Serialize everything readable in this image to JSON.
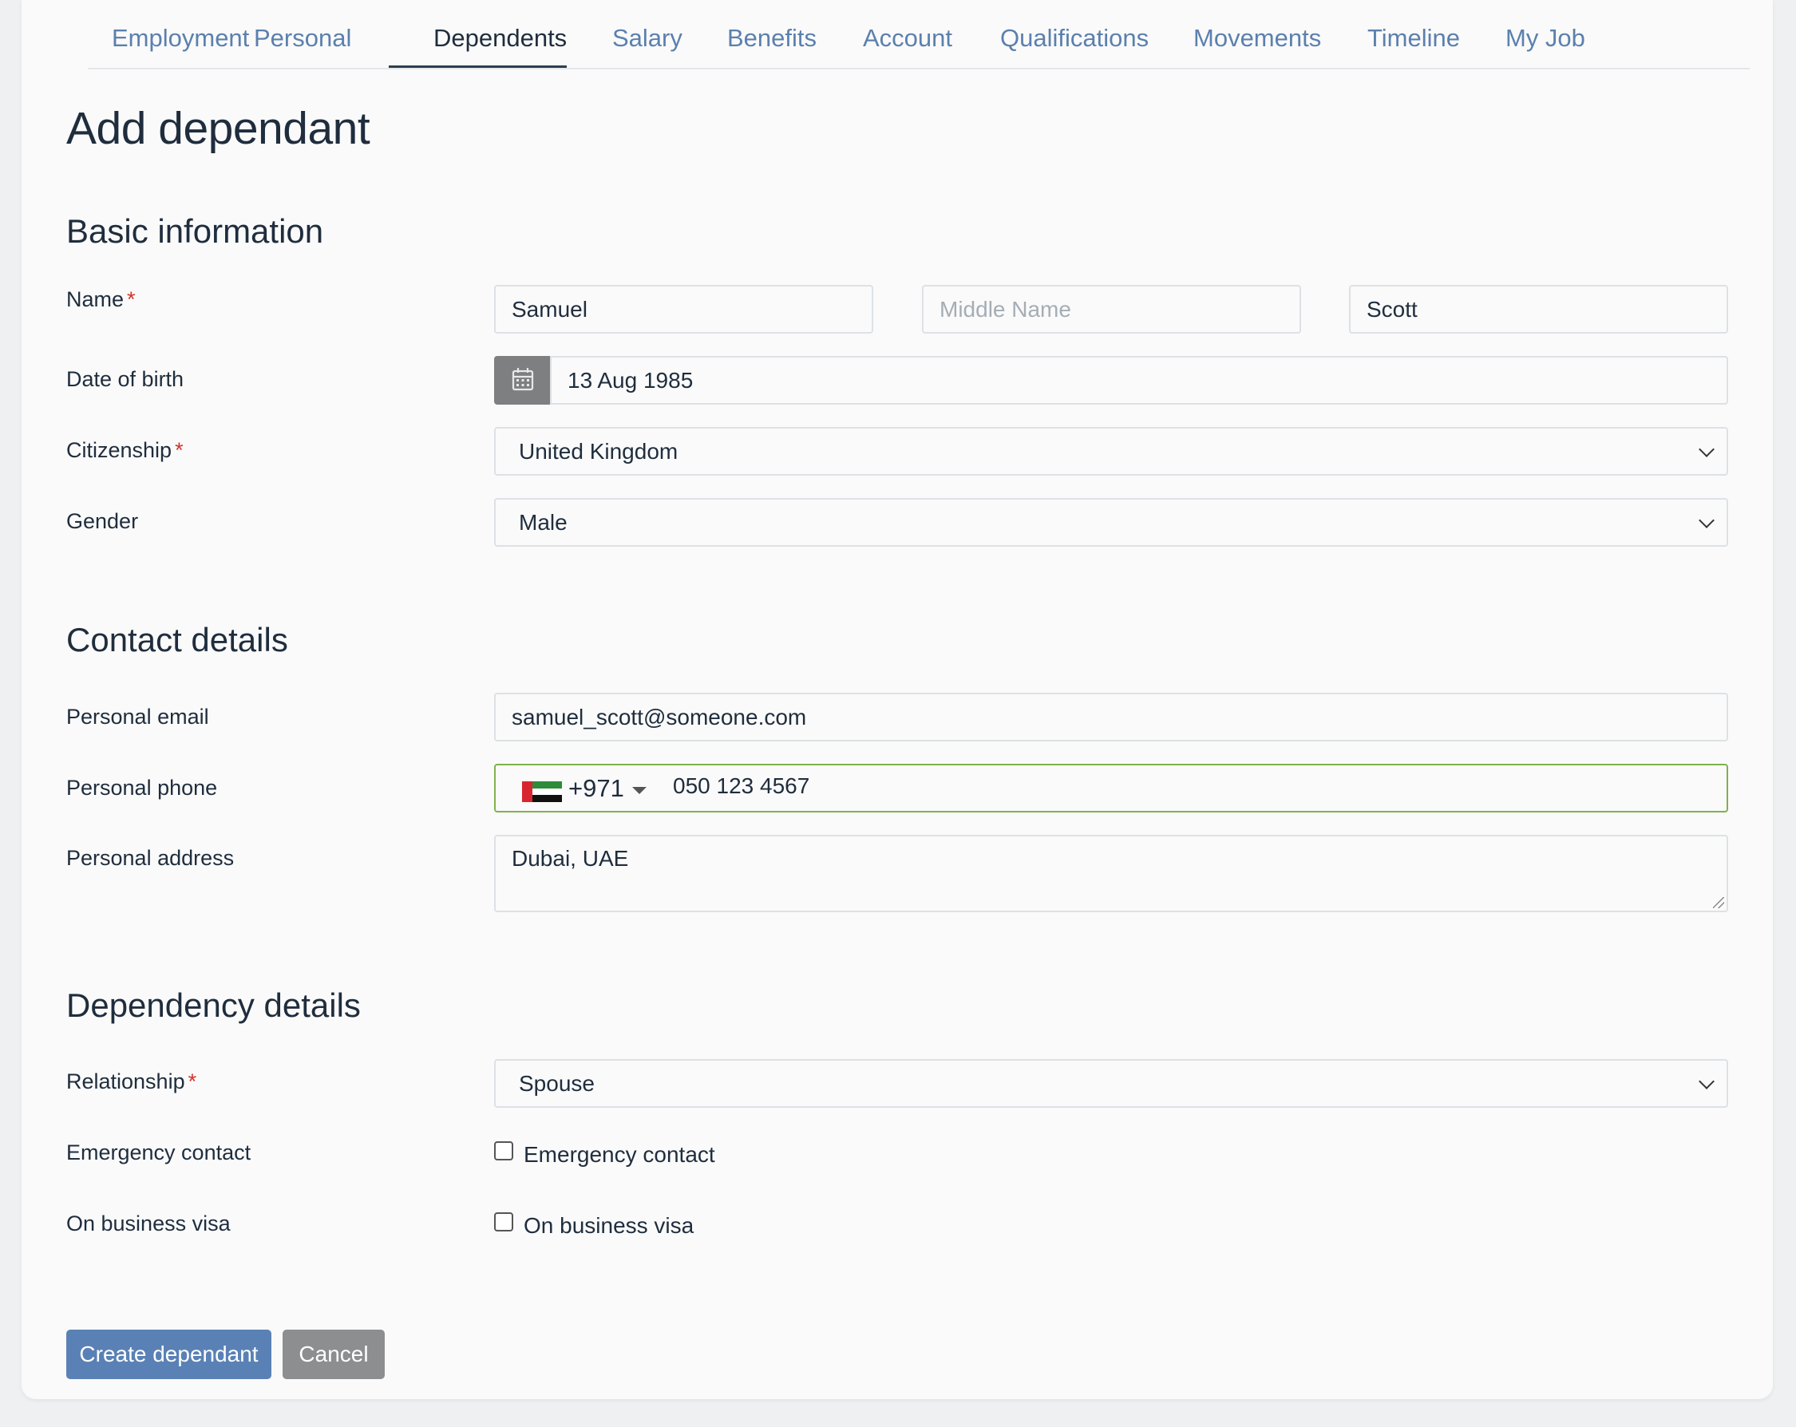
{
  "tabs": [
    "Employment",
    "Personal",
    "Dependents",
    "Salary",
    "Benefits",
    "Account",
    "Qualifications",
    "Movements",
    "Timeline",
    "My Job"
  ],
  "active_tab": "Dependents",
  "page_title": "Add dependant",
  "sections": {
    "basic": "Basic information",
    "contact": "Contact details",
    "dependency": "Dependency details"
  },
  "basic": {
    "name_label": "Name",
    "first_name": "Samuel",
    "middle_name_placeholder": "Middle Name",
    "last_name": "Scott",
    "dob_label": "Date of birth",
    "dob_value": "13 Aug 1985",
    "citizenship_label": "Citizenship",
    "citizenship_value": "United Kingdom",
    "gender_label": "Gender",
    "gender_value": "Male"
  },
  "contact": {
    "email_label": "Personal email",
    "email_value": "samuel_scott@someone.com",
    "phone_label": "Personal phone",
    "phone_dial_code": "+971",
    "phone_number": "050 123 4567",
    "phone_flag": "uae-flag-icon",
    "address_label": "Personal address",
    "address_value": "Dubai, UAE"
  },
  "dependency": {
    "relationship_label": "Relationship",
    "relationship_value": "Spouse",
    "emergency_label": "Emergency contact",
    "emergency_checkbox_label": "Emergency contact",
    "visa_label": "On business visa",
    "visa_checkbox_label": "On business visa"
  },
  "required_marker": "*",
  "buttons": {
    "create": "Create dependant",
    "cancel": "Cancel"
  },
  "colors": {
    "link": "#5b80ae",
    "primary_button": "#5a81b5",
    "secondary_button": "#8c8e90",
    "required": "#d0342c",
    "phone_focus_border": "#7fb24c"
  }
}
